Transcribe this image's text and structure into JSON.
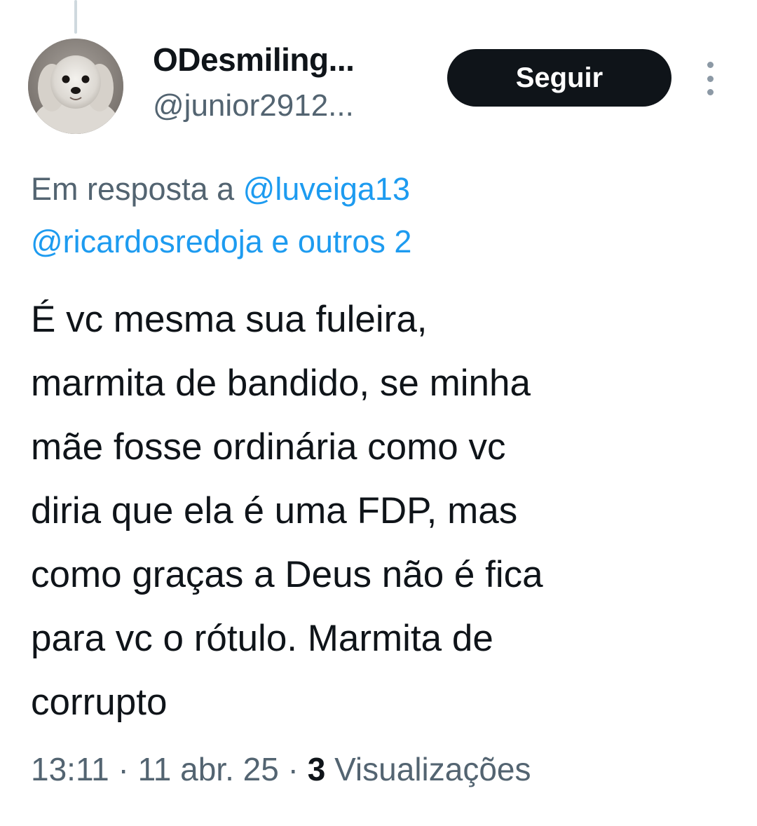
{
  "author": {
    "display_name": "ODesmiling...",
    "handle": "@junior2912...",
    "avatar_description": "avatar"
  },
  "actions": {
    "follow_label": "Seguir",
    "more_icon": "more-vertical-icon"
  },
  "reply_context": {
    "prefix": "Em resposta a ",
    "mention_1": "@luveiga13",
    "mention_2": "@ricardosredoja",
    "suffix": " e outros 2"
  },
  "tweet": {
    "text": "É vc mesma sua fuleira,\nmarmita de bandido, se minha\nmãe fosse ordinária como vc\ndiria que ela é uma FDP, mas\ncomo graças a Deus não é fica\npara vc o rótulo. Marmita de\ncorrupto"
  },
  "meta": {
    "time": "13:11",
    "separator": " · ",
    "date": "11 abr. 25",
    "views_count": "3",
    "views_label": " Visualizações"
  },
  "colors": {
    "text": "#0f1419",
    "secondary": "#536471",
    "link": "#1d9bf0",
    "button_bg": "#0f1419"
  }
}
